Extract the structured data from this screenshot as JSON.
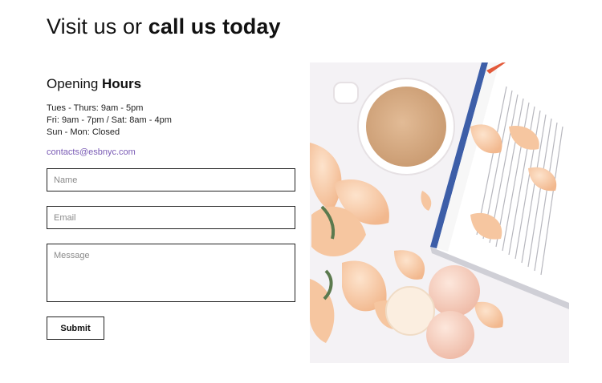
{
  "header": {
    "title_light": "Visit us or ",
    "title_bold": "call us today"
  },
  "hours": {
    "title_light": "Opening ",
    "title_bold": "Hours",
    "lines": [
      "Tues - Thurs: 9am - 5pm",
      "Fri: 9am - 7pm / Sat: 8am - 4pm",
      "Sun - Mon: Closed"
    ],
    "email": "contacts@esbnyc.com"
  },
  "form": {
    "name_placeholder": "Name",
    "email_placeholder": "Email",
    "message_placeholder": "Message",
    "submit_label": "Submit"
  },
  "colors": {
    "link": "#7a5bb5",
    "border": "#222222",
    "peach": "#f6c6a0",
    "coffee": "#d8ad86"
  }
}
